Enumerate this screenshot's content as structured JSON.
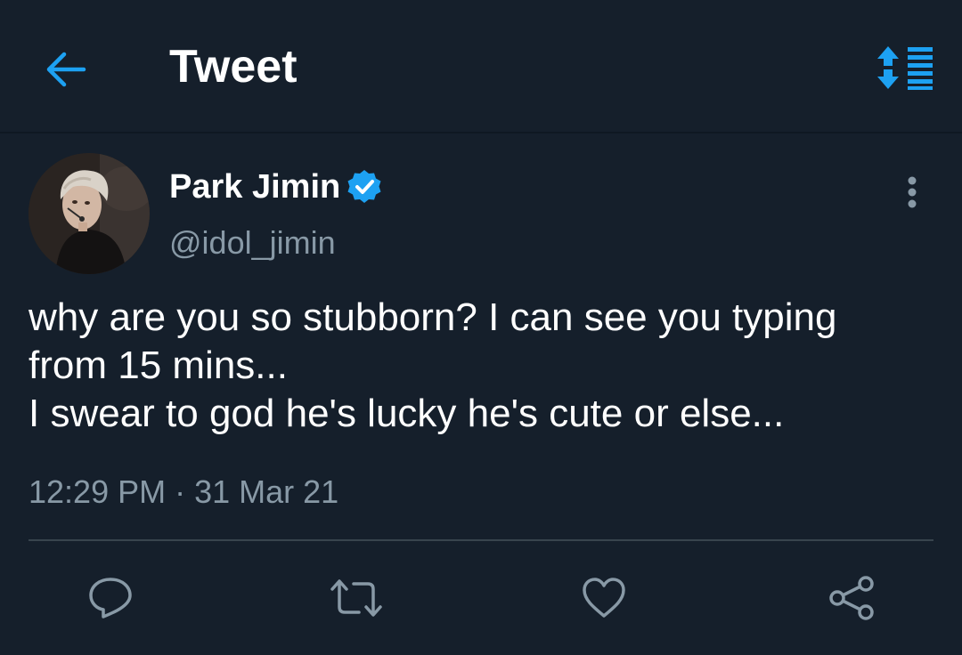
{
  "header": {
    "title": "Tweet",
    "back_icon": "arrow-left-icon",
    "sort_icon": "sort-list-icon",
    "accent_color": "#1da1f2"
  },
  "tweet": {
    "author": {
      "name": "Park Jimin",
      "handle": "@idol_jimin",
      "verified": true,
      "verified_icon": "verified-badge-icon"
    },
    "text_lines": [
      "why are you so stubborn? I can see you typing",
      "from 15 mins...",
      "I swear to god he's lucky he's cute or else..."
    ],
    "timestamp": "12:29 PM · 31 Mar 21"
  },
  "actions": [
    {
      "name": "reply",
      "icon": "reply-icon"
    },
    {
      "name": "retweet",
      "icon": "retweet-icon"
    },
    {
      "name": "like",
      "icon": "heart-icon"
    },
    {
      "name": "share",
      "icon": "share-icon"
    }
  ],
  "colors": {
    "background": "#151f2b",
    "secondary_text": "#8899a6",
    "divider": "#38444d",
    "verified_blue": "#1da1f2"
  }
}
